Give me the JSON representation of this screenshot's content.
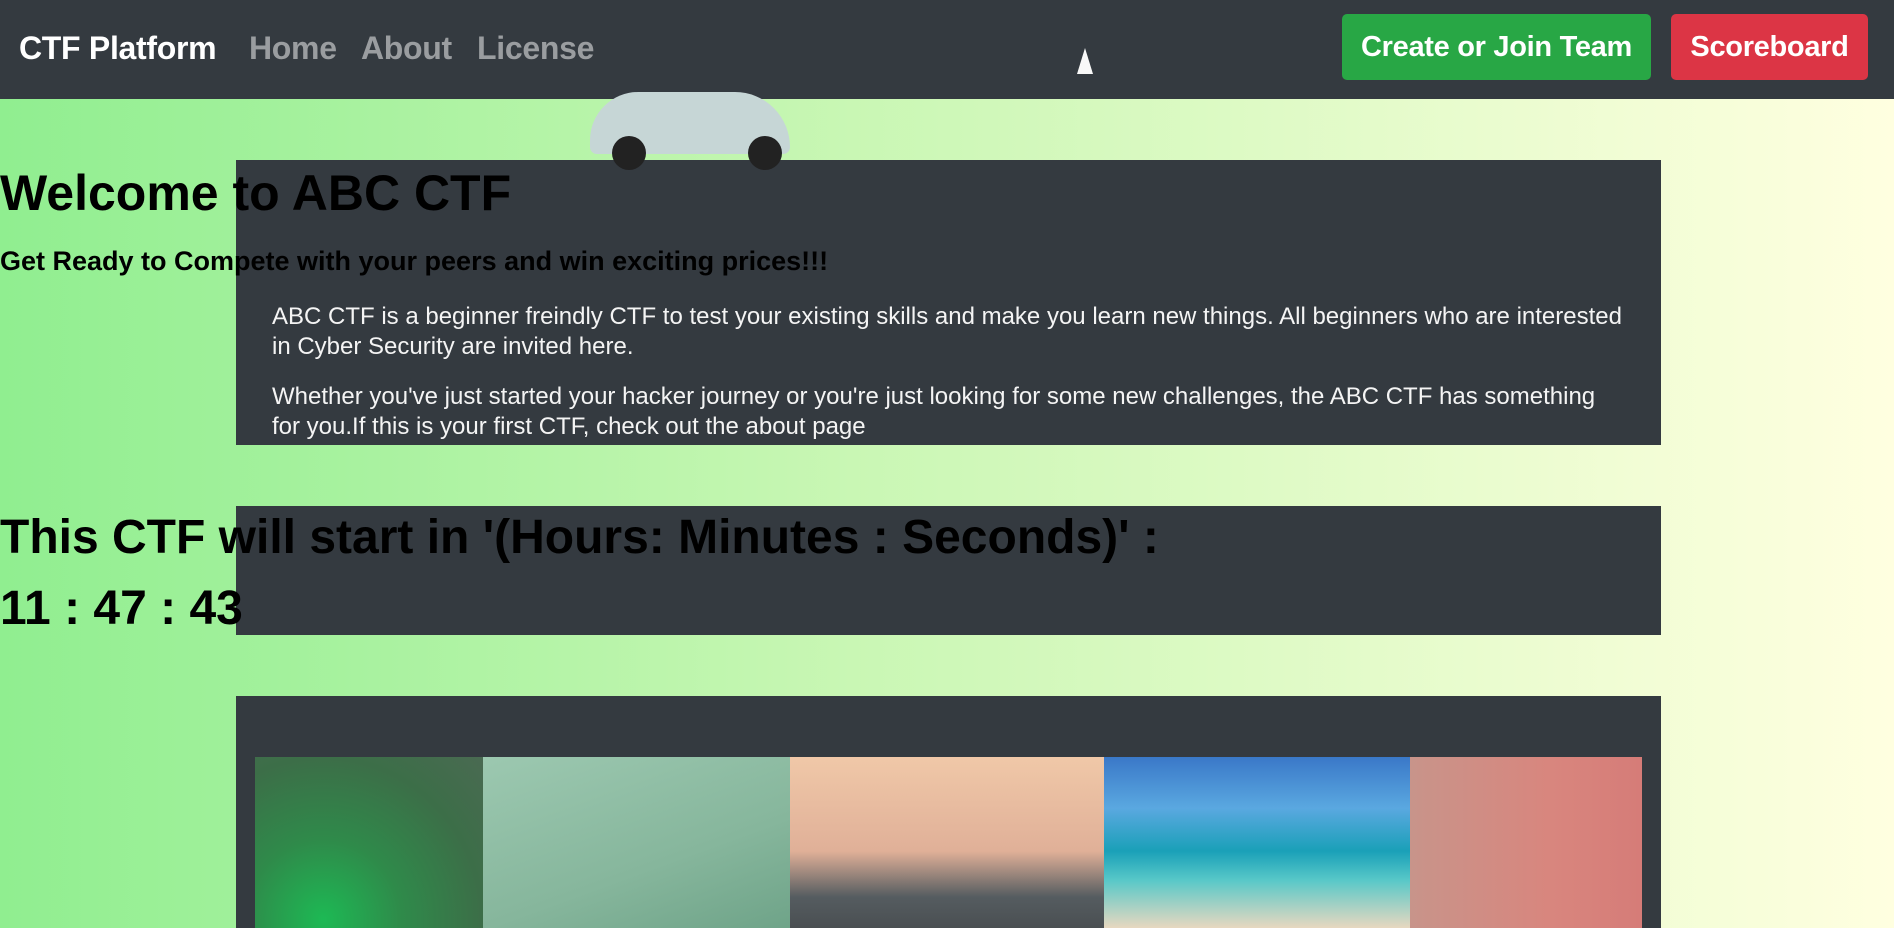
{
  "navbar": {
    "brand": "CTF Platform",
    "links": [
      "Home",
      "About",
      "License"
    ],
    "team_button": "Create or Join Team",
    "scoreboard_button": "Scoreboard"
  },
  "welcome": {
    "title": "Welcome to ABC CTF",
    "subtitle": "Get Ready to Compete with your peers and win exciting prices!!!",
    "paragraph_1": "ABC CTF is a beginner freindly CTF to test your existing skills and make you learn new things. All beginners who are interested in Cyber Security are invited here.",
    "paragraph_2": "Whether you've just started your hacker journey or you're just looking for some new challenges, the ABC CTF has something for you.If this is your first CTF, check out the about page"
  },
  "countdown": {
    "label": "This CTF will start in '(Hours: Minutes : Seconds)' :",
    "value": "11 : 47 : 43"
  },
  "colors": {
    "navbar_bg": "#343a40",
    "card_bg": "#343a40",
    "team_button": "#28a745",
    "scoreboard_button": "#dc3545",
    "gradient_start": "#90ee90",
    "gradient_end": "#ffffe0"
  }
}
